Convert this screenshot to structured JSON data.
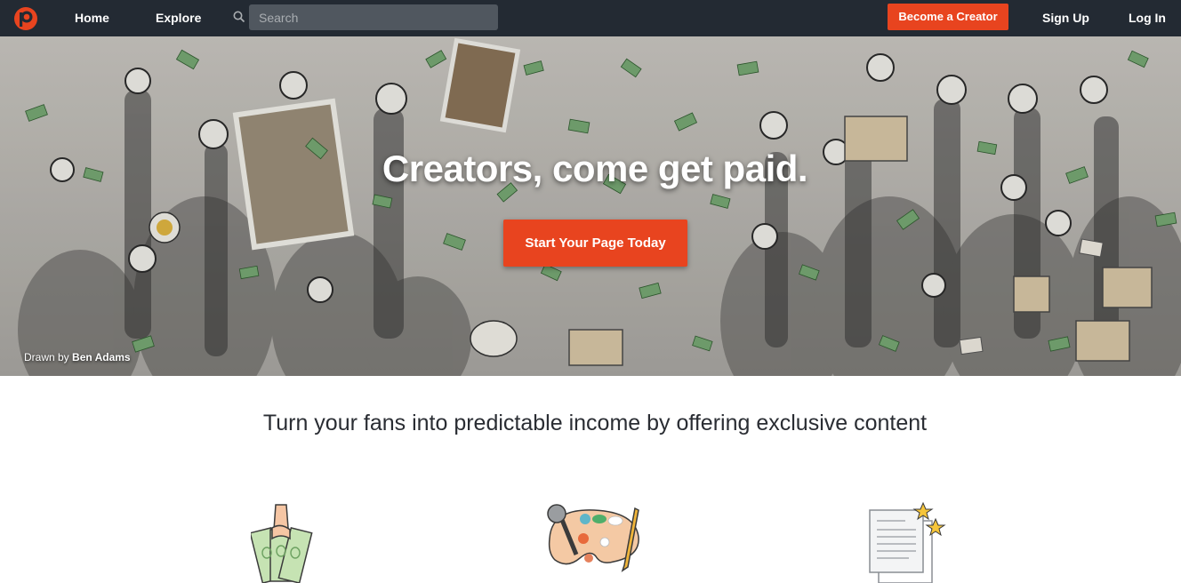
{
  "nav": {
    "logo_icon": "patreon-logo-icon",
    "home_label": "Home",
    "explore_label": "Explore",
    "search_placeholder": "Search",
    "search_value": "",
    "become_creator_label": "Become a Creator",
    "sign_up_label": "Sign Up",
    "log_in_label": "Log In",
    "colors": {
      "bar": "#232a33",
      "accent": "#e8441f"
    }
  },
  "hero": {
    "title": "Creators, come get paid.",
    "cta_label": "Start Your Page Today",
    "credit_prefix": "Drawn by",
    "credit_name": "Ben Adams"
  },
  "main": {
    "tagline": "Turn your fans into predictable income by offering exclusive content",
    "features": [
      {
        "icon": "money-hand-icon"
      },
      {
        "icon": "art-palette-microphone-icon"
      },
      {
        "icon": "documents-stars-icon"
      }
    ]
  }
}
